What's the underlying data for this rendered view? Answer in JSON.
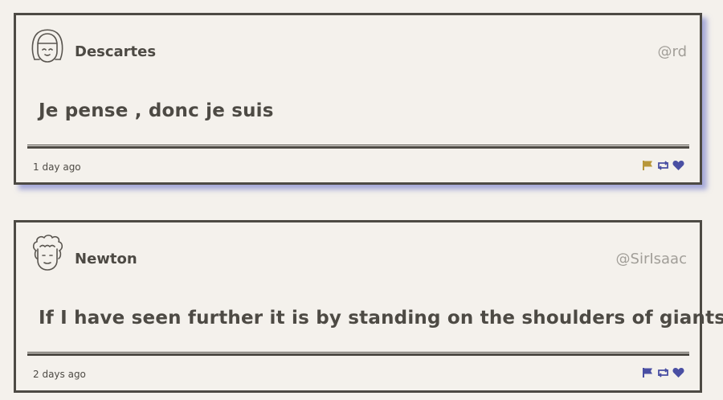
{
  "tweets": [
    {
      "name": "Descartes",
      "handle": "@rd",
      "message": "Je pense , donc je suis",
      "time": "1 day ago",
      "avatar_icon": "woman-face-icon",
      "flag_color": "#b8973a",
      "action_color": "#4a4fa3"
    },
    {
      "name": "Newton",
      "handle": "@SirIsaac",
      "message": "If I have seen further it is by standing on the shoulders of giants",
      "time": "2 days ago",
      "avatar_icon": "curly-hair-face-icon",
      "flag_color": "#4a4fa3",
      "action_color": "#4a4fa3"
    }
  ]
}
